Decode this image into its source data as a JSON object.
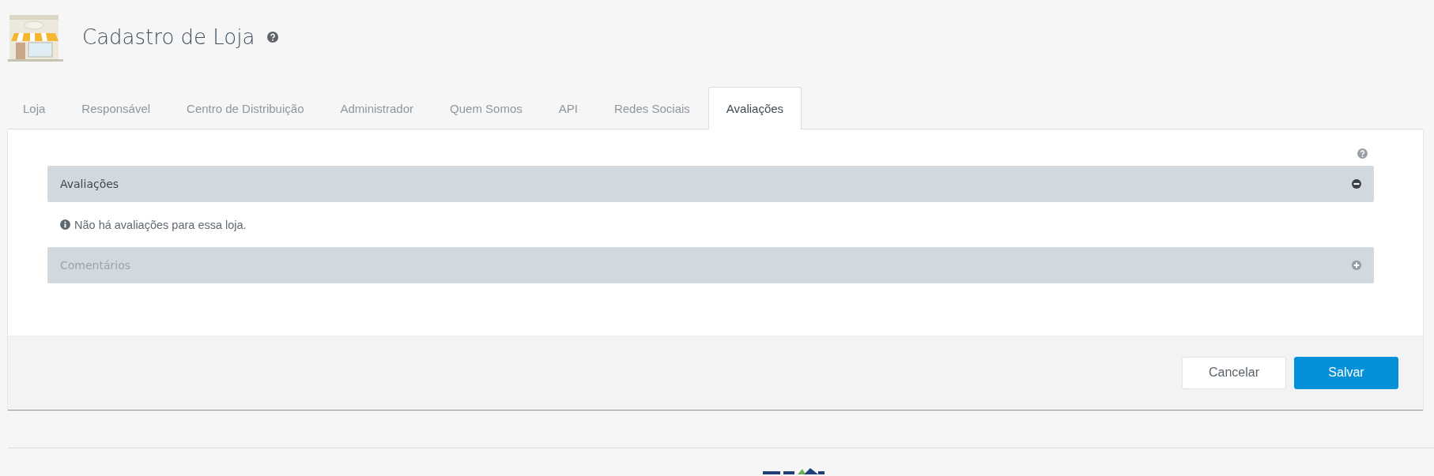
{
  "header": {
    "title": "Cadastro de Loja"
  },
  "tabs": [
    {
      "label": "Loja",
      "selected": false
    },
    {
      "label": "Responsável",
      "selected": false
    },
    {
      "label": "Centro de Distribuição",
      "selected": false
    },
    {
      "label": "Administrador",
      "selected": false
    },
    {
      "label": "Quem Somos",
      "selected": false
    },
    {
      "label": "API",
      "selected": false
    },
    {
      "label": "Redes Sociais",
      "selected": false
    },
    {
      "label": "Avaliações",
      "selected": true
    }
  ],
  "sections": [
    {
      "title": "Avaliações",
      "expanded": true,
      "message": "Não há avaliações para essa loja."
    },
    {
      "title": "Comentários",
      "expanded": false
    }
  ],
  "buttons": [
    {
      "label": "Cancelar",
      "kind": "secondary"
    },
    {
      "label": "Salvar",
      "kind": "primary"
    }
  ]
}
